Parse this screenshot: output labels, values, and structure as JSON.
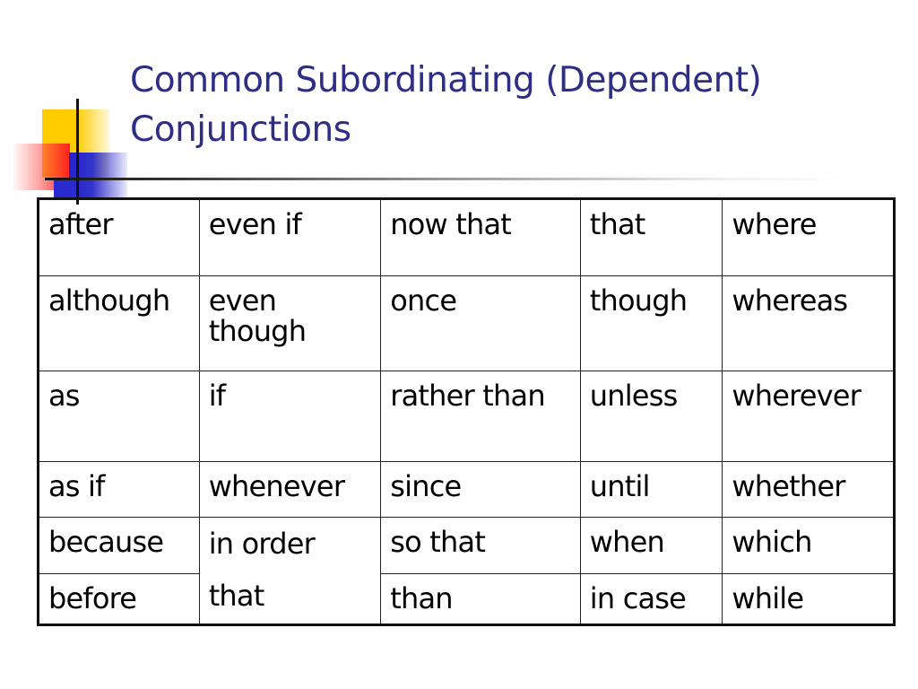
{
  "slide": {
    "title_line1": "Common Subordinating (Dependent)",
    "title_line2": "Conjunctions",
    "accent_color": "#2e2e86"
  },
  "table": {
    "rows": [
      [
        "after",
        "even if",
        "now that",
        "that",
        "where"
      ],
      [
        "although",
        "even though",
        "once",
        "though",
        "whereas"
      ],
      [
        "as",
        "if",
        "rather than",
        "unless",
        "wherever"
      ],
      [
        "as if",
        "whenever",
        "since",
        "until",
        "whether"
      ],
      [
        "because",
        "in order that",
        "so that",
        "when",
        "which"
      ],
      [
        "before",
        null,
        "than",
        "in case",
        "while"
      ]
    ],
    "cells": {
      "r0": {
        "c0": "after",
        "c1": "even if",
        "c2": "now that",
        "c3": "that",
        "c4": "where"
      },
      "r1": {
        "c0": "although",
        "c1a": "even",
        "c1b": "though",
        "c2": "once",
        "c3": "though",
        "c4": "whereas"
      },
      "r2": {
        "c0": "as",
        "c1": "if",
        "c2": "rather than",
        "c3": "unless",
        "c4": "wherever"
      },
      "r3": {
        "c0": "as if",
        "c1": "whenever",
        "c2": "since",
        "c3": "until",
        "c4": "whether"
      },
      "r4": {
        "c0": "because",
        "c1a": "in order",
        "c1b": "that",
        "c2": "so that",
        "c3": "when",
        "c4": "which"
      },
      "r5": {
        "c0": "before",
        "c2": "than",
        "c3": "in case",
        "c4": "while"
      }
    }
  }
}
